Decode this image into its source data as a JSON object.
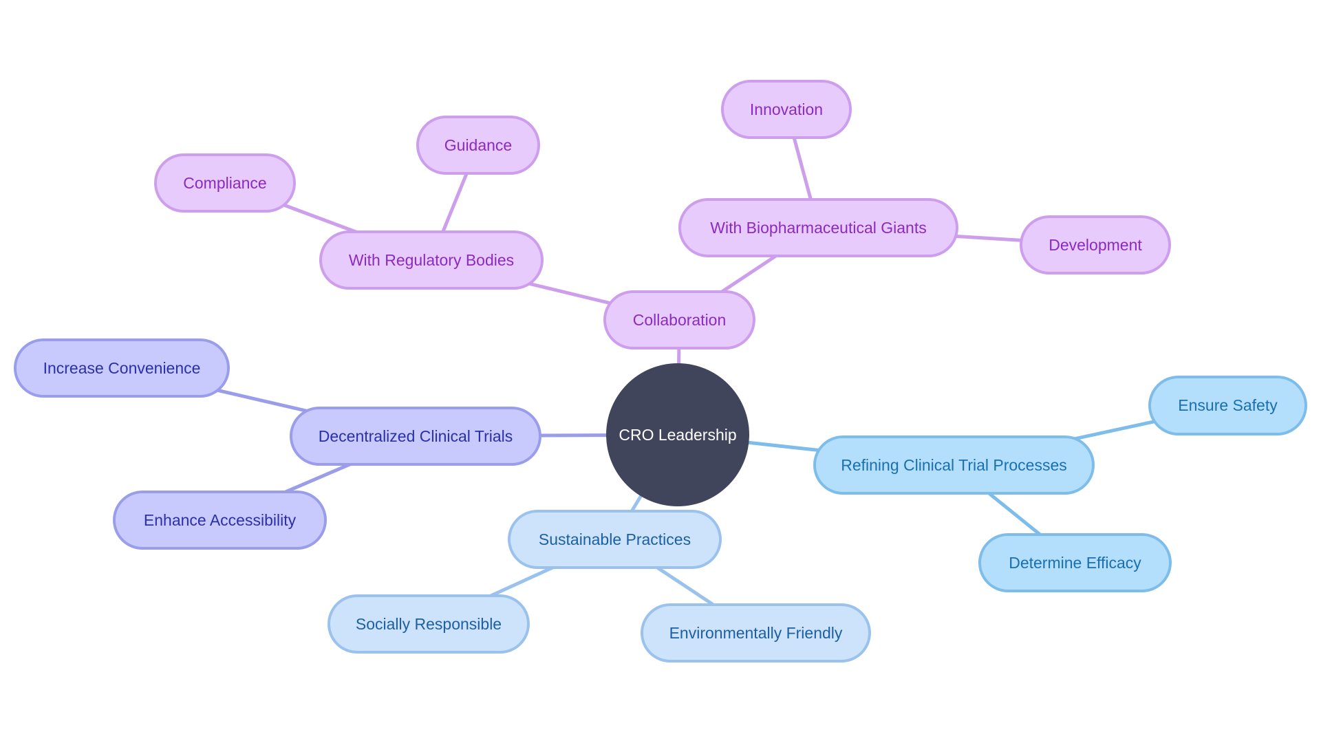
{
  "diagram": {
    "type": "mindmap",
    "root": {
      "id": "root",
      "label": "CRO Leadership"
    },
    "branch_colors": {
      "purple": {
        "fill": "#E8CBFD",
        "stroke": "#CC9EEB",
        "text": "#8A2BBF"
      },
      "blue": {
        "fill": "#B3DFFD",
        "stroke": "#7EBDEA",
        "text": "#1A6FB0"
      },
      "lblue": {
        "fill": "#CDE3FB",
        "stroke": "#9BC2EC",
        "text": "#1D5FA3"
      },
      "indigo": {
        "fill": "#C8CAFD",
        "stroke": "#9A9EEA",
        "text": "#2B2FA8"
      },
      "root": {
        "fill": "#41455C",
        "text": "#FFFFFF"
      }
    },
    "nodes": [
      {
        "id": "collab",
        "label": "Collaboration",
        "parent": "root",
        "color": "purple"
      },
      {
        "id": "reg",
        "label": "With Regulatory Bodies",
        "parent": "collab",
        "color": "purple"
      },
      {
        "id": "compliance",
        "label": "Compliance",
        "parent": "reg",
        "color": "purple"
      },
      {
        "id": "guidance",
        "label": "Guidance",
        "parent": "reg",
        "color": "purple"
      },
      {
        "id": "bio",
        "label": "With Biopharmaceutical Giants",
        "parent": "collab",
        "color": "purple"
      },
      {
        "id": "innovation",
        "label": "Innovation",
        "parent": "bio",
        "color": "purple"
      },
      {
        "id": "development",
        "label": "Development",
        "parent": "bio",
        "color": "purple"
      },
      {
        "id": "dct",
        "label": "Decentralized Clinical Trials",
        "parent": "root",
        "color": "indigo"
      },
      {
        "id": "convenience",
        "label": "Increase Convenience",
        "parent": "dct",
        "color": "indigo"
      },
      {
        "id": "access",
        "label": "Enhance Accessibility",
        "parent": "dct",
        "color": "indigo"
      },
      {
        "id": "refine",
        "label": "Refining Clinical Trial Processes",
        "parent": "root",
        "color": "blue"
      },
      {
        "id": "safety",
        "label": "Ensure Safety",
        "parent": "refine",
        "color": "blue"
      },
      {
        "id": "efficacy",
        "label": "Determine Efficacy",
        "parent": "refine",
        "color": "blue"
      },
      {
        "id": "sustain",
        "label": "Sustainable Practices",
        "parent": "root",
        "color": "lblue"
      },
      {
        "id": "social",
        "label": "Socially Responsible",
        "parent": "sustain",
        "color": "lblue"
      },
      {
        "id": "env",
        "label": "Environmentally Friendly",
        "parent": "sustain",
        "color": "lblue"
      }
    ]
  }
}
